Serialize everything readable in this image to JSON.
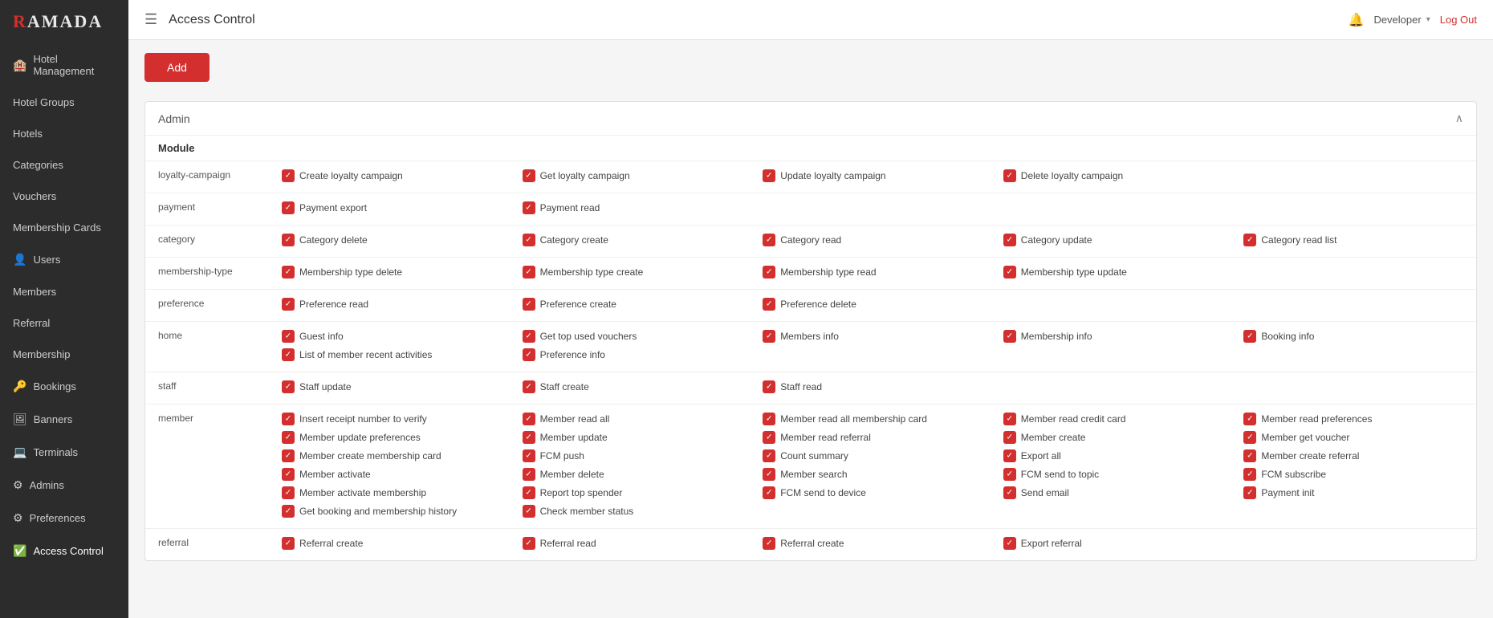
{
  "app": {
    "logo": "RAMADA",
    "page_title": "Access Control",
    "user": "Developer",
    "logout_label": "Log Out",
    "add_button": "Add"
  },
  "sidebar": {
    "items": [
      {
        "label": "Hotel Management",
        "icon": "🏨",
        "active": false
      },
      {
        "label": "Hotel Groups",
        "icon": "",
        "active": false
      },
      {
        "label": "Hotels",
        "icon": "",
        "active": false
      },
      {
        "label": "Categories",
        "icon": "",
        "active": false
      },
      {
        "label": "Vouchers",
        "icon": "",
        "active": false
      },
      {
        "label": "Membership Cards",
        "icon": "",
        "active": false
      },
      {
        "label": "Users",
        "icon": "👤",
        "active": false
      },
      {
        "label": "Members",
        "icon": "",
        "active": false
      },
      {
        "label": "Referral",
        "icon": "",
        "active": false
      },
      {
        "label": "Membership",
        "icon": "",
        "active": false
      },
      {
        "label": "Bookings",
        "icon": "🔑",
        "active": false
      },
      {
        "label": "Banners",
        "icon": "🖼",
        "active": false
      },
      {
        "label": "Terminals",
        "icon": "💻",
        "active": false
      },
      {
        "label": "Admins",
        "icon": "⚙",
        "active": false
      },
      {
        "label": "Preferences",
        "icon": "⚙",
        "active": false
      },
      {
        "label": "Access Control",
        "icon": "✅",
        "active": true
      }
    ]
  },
  "admin_section": {
    "title": "Admin",
    "module_header": "Module",
    "rows": [
      {
        "module": "loyalty-campaign",
        "permissions": [
          [
            "Create loyalty campaign"
          ],
          [
            "Get loyalty campaign"
          ],
          [
            "Update loyalty campaign"
          ],
          [
            "Delete loyalty campaign"
          ],
          []
        ]
      },
      {
        "module": "payment",
        "permissions": [
          [
            "Payment export"
          ],
          [
            "Payment read"
          ],
          [],
          [],
          []
        ]
      },
      {
        "module": "category",
        "permissions": [
          [
            "Category delete"
          ],
          [
            "Category create"
          ],
          [
            "Category read"
          ],
          [
            "Category update"
          ],
          [
            "Category read list"
          ]
        ]
      },
      {
        "module": "membership-type",
        "permissions": [
          [
            "Membership type delete"
          ],
          [
            "Membership type create"
          ],
          [
            "Membership type read"
          ],
          [
            "Membership type update"
          ],
          []
        ]
      },
      {
        "module": "preference",
        "permissions": [
          [
            "Preference read"
          ],
          [
            "Preference create"
          ],
          [
            "Preference delete"
          ],
          [],
          []
        ]
      },
      {
        "module": "home",
        "permissions": [
          [
            "Guest info",
            "List of member recent activities"
          ],
          [
            "Get top used vouchers",
            "Preference info"
          ],
          [
            "Members info"
          ],
          [
            "Membership info"
          ],
          [
            "Booking info"
          ]
        ]
      },
      {
        "module": "staff",
        "permissions": [
          [
            "Staff update"
          ],
          [
            "Staff create"
          ],
          [
            "Staff read"
          ],
          [],
          []
        ]
      },
      {
        "module": "member",
        "permissions": [
          [
            "Insert receipt number to verify",
            "Member update preferences",
            "Member create membership card",
            "Member activate",
            "Member activate membership",
            "Get booking and membership history"
          ],
          [
            "Member read all",
            "Member update",
            "FCM push",
            "Member delete",
            "Report top spender",
            "Check member status"
          ],
          [
            "Member read all membership card",
            "Member read referral",
            "Count summary",
            "Member search",
            "FCM send to device"
          ],
          [
            "Member read credit card",
            "Member create",
            "Export all",
            "FCM send to topic",
            "Send email"
          ],
          [
            "Member read preferences",
            "Member get voucher",
            "Member create referral",
            "FCM subscribe",
            "Payment init"
          ]
        ]
      },
      {
        "module": "referral",
        "permissions": [
          [
            "Referral create"
          ],
          [
            "Referral read"
          ],
          [
            "Referral create"
          ],
          [
            "Export referral"
          ],
          []
        ]
      }
    ]
  }
}
